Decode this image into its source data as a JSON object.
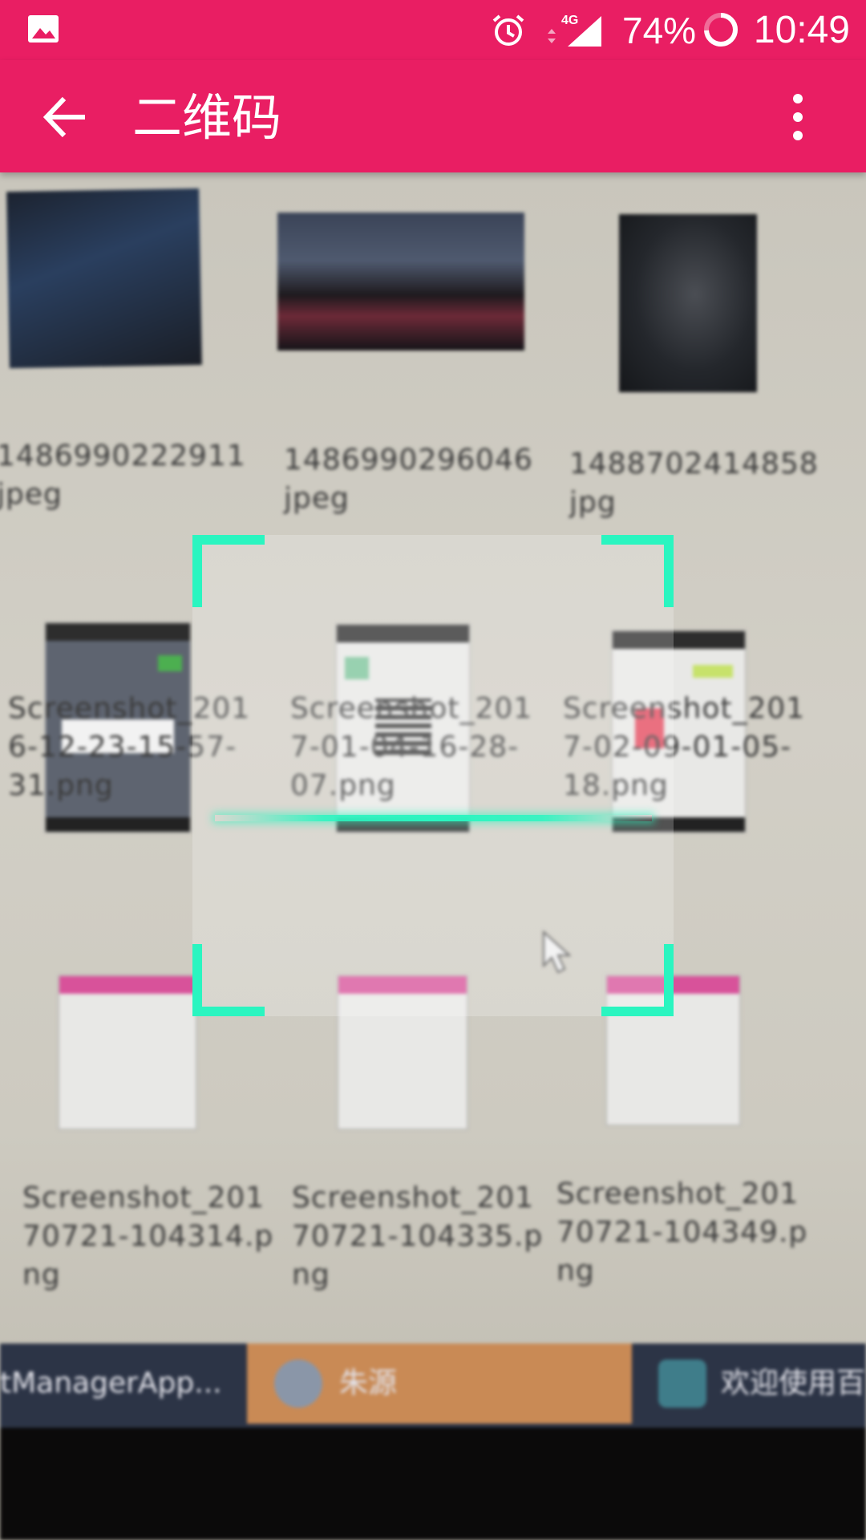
{
  "status_bar": {
    "network": "4G",
    "battery": "74%",
    "time": "10:49"
  },
  "app_bar": {
    "title": "二维码"
  },
  "camera_view": {
    "files": {
      "row1": [
        {
          "name_line1": "1486990222911",
          "name_line2": "jpeg"
        },
        {
          "name_line1": "1486990296046",
          "name_line2": "jpeg"
        },
        {
          "name_line1": "1488702414858",
          "name_line2": "jpg"
        }
      ],
      "row2": [
        {
          "name_line1": "Screenshot_201",
          "name_line2": "6-12-23-15-57-",
          "name_line3": "31.png"
        },
        {
          "name_line1": "Screenshot_201",
          "name_line2": "7-01-04-16-28-",
          "name_line3": "07.png"
        },
        {
          "name_line1": "Screenshot_201",
          "name_line2": "7-02-09-01-05-",
          "name_line3": "18.png"
        }
      ],
      "row3": [
        {
          "name_line1": "Screenshot_201",
          "name_line2": "70721-104314.p",
          "name_line3": "ng"
        },
        {
          "name_line1": "Screenshot_201",
          "name_line2": "70721-104335.p",
          "name_line3": "ng"
        },
        {
          "name_line1": "Screenshot_201",
          "name_line2": "70721-104349.p",
          "name_line3": "ng"
        }
      ]
    },
    "taskbar": [
      {
        "label": "tManagerApp..."
      },
      {
        "label": "朱源"
      },
      {
        "label": "欢迎使用百"
      }
    ]
  },
  "scanner": {
    "frame_color": "#2af5c0"
  },
  "colors": {
    "primary": "#e91e63",
    "scan_accent": "#2af5c0"
  },
  "icons": [
    "gallery-icon",
    "alarm-icon",
    "signal-icon",
    "battery-ring-icon",
    "back-arrow-icon",
    "overflow-menu-icon"
  ]
}
